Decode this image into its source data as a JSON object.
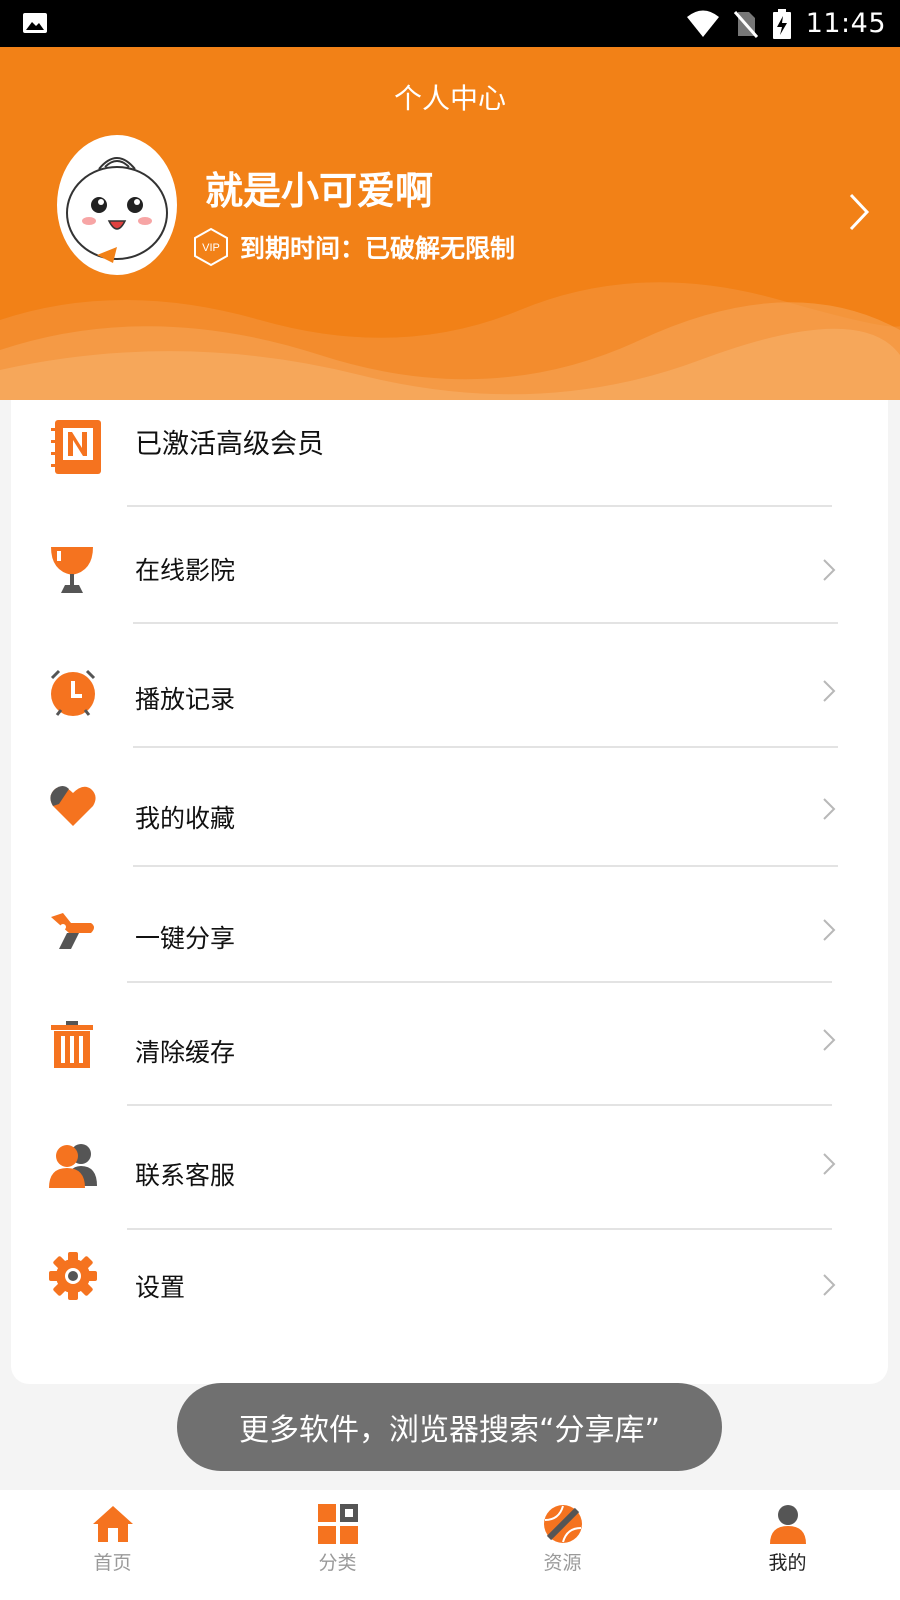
{
  "status_bar": {
    "time": "11:45"
  },
  "header": {
    "title": "个人中心",
    "username": "就是小可爱啊",
    "vip_badge": "VIP",
    "expiry_text": "到期时间：已破解无限制"
  },
  "menu": [
    {
      "label": "已激活高级会员",
      "icon": "notebook-n-icon"
    },
    {
      "label": "在线影院",
      "icon": "trophy-cup-icon"
    },
    {
      "label": "播放记录",
      "icon": "alarm-clock-icon"
    },
    {
      "label": "我的收藏",
      "icon": "heart-icon"
    },
    {
      "label": "一键分享",
      "icon": "share-plane-icon"
    },
    {
      "label": "清除缓存",
      "icon": "trash-icon"
    },
    {
      "label": "联系客服",
      "icon": "contacts-icon"
    },
    {
      "label": "设置",
      "icon": "gear-icon"
    }
  ],
  "toast": "更多软件，浏览器搜索“分享库”",
  "bottom_nav": [
    {
      "label": "首页",
      "icon": "home-icon",
      "active": false
    },
    {
      "label": "分类",
      "icon": "grid-icon",
      "active": false
    },
    {
      "label": "资源",
      "icon": "ball-icon",
      "active": false
    },
    {
      "label": "我的",
      "icon": "person-icon",
      "active": true
    }
  ],
  "colors": {
    "accent": "#f28117",
    "icon": "#f5731f"
  }
}
